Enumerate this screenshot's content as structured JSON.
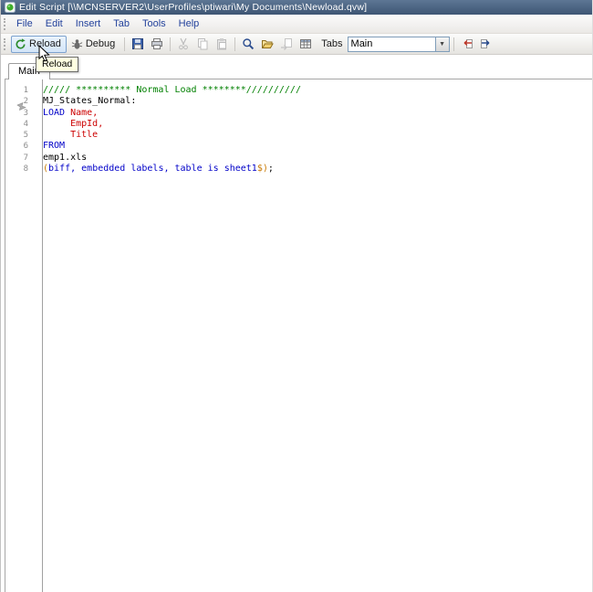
{
  "window": {
    "title": "Edit Script [\\\\MCNSERVER2\\UserProfiles\\ptiwari\\My Documents\\Newload.qvw]"
  },
  "menu": {
    "items": [
      "File",
      "Edit",
      "Insert",
      "Tab",
      "Tools",
      "Help"
    ]
  },
  "toolbar": {
    "reload_label": "Reload",
    "debug_label": "Debug",
    "tabs_label": "Tabs",
    "tab_select_value": "Main"
  },
  "tooltip": {
    "text": "Reload"
  },
  "tabs": {
    "active": "Main"
  },
  "editor": {
    "lines": [
      {
        "num": "1",
        "segments": [
          {
            "type": "comment",
            "text": "///// ********** Normal Load ********//////////"
          }
        ]
      },
      {
        "num": "2",
        "segments": [
          {
            "type": "plain",
            "text": "MJ_States_Normal:"
          }
        ]
      },
      {
        "num": "3",
        "segments": [
          {
            "type": "keyword",
            "text": "LOAD "
          },
          {
            "type": "field",
            "text": "Name,"
          }
        ]
      },
      {
        "num": "4",
        "segments": [
          {
            "type": "field",
            "text": "     EmpId,"
          }
        ]
      },
      {
        "num": "5",
        "segments": [
          {
            "type": "field",
            "text": "     Title"
          }
        ]
      },
      {
        "num": "6",
        "segments": [
          {
            "type": "keyword",
            "text": "FROM"
          }
        ]
      },
      {
        "num": "7",
        "segments": [
          {
            "type": "plain",
            "text": "emp1.xls"
          }
        ]
      },
      {
        "num": "8",
        "segments": [
          {
            "type": "symbol",
            "text": "("
          },
          {
            "type": "keyword",
            "text": "biff, embedded labels, table is sheet1"
          },
          {
            "type": "symbol",
            "text": "$)"
          },
          {
            "type": "plain",
            "text": ";"
          }
        ]
      }
    ]
  },
  "icons": {
    "app_icon": "green-ball-window-icon",
    "reload_icon": "green-circular-arrow",
    "debug_icon": "gray-bug",
    "save_icon": "blue-floppy-disk",
    "print_icon": "printer",
    "cut_icon": "scissors-disabled",
    "copy_icon": "two-pages-disabled",
    "paste_icon": "clipboard-disabled",
    "find_icon": "magnifier",
    "open_folder_icon": "open-yellow-folder",
    "insert_file_icon": "page-with-arrow-disabled",
    "table_viewer_icon": "table-grid",
    "promote_tab_icon": "tab-with-red-arrow",
    "demote_tab_icon": "tab-with-blue-arrow",
    "combo_dropdown_icon": "down-triangle",
    "gutter_pointer_icon": "gray-pointer",
    "mouse_cursor": "arrow-pointer"
  },
  "colors": {
    "comment": "#008000",
    "keyword": "#0000c8",
    "field": "#cc0000",
    "plain": "#000000",
    "symbol": "#c87800",
    "menu_text": "#23429c",
    "tooltip_bg": "#ffffe1",
    "titlebar_top": "#5d7694",
    "titlebar_bottom": "#3e5674",
    "line_number": "#8c8c8c"
  }
}
